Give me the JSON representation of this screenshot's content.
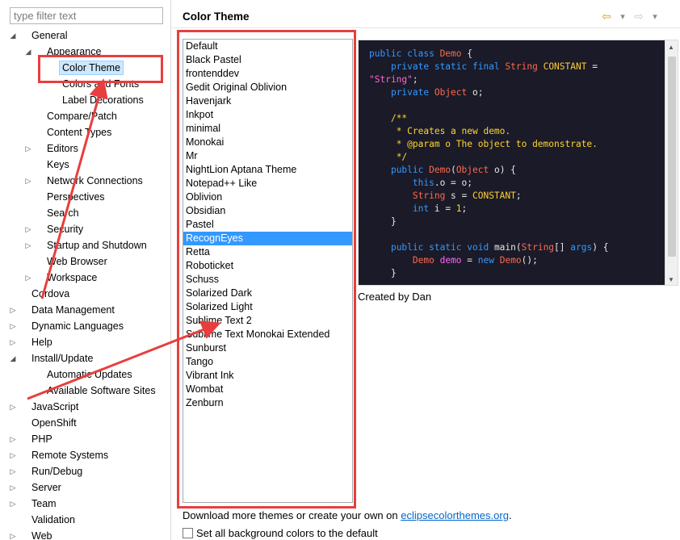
{
  "filter": {
    "placeholder": "type filter text",
    "value": ""
  },
  "tree": [
    {
      "label": "General",
      "depth": 0,
      "expander": "open",
      "selected": false
    },
    {
      "label": "Appearance",
      "depth": 1,
      "expander": "open",
      "selected": false
    },
    {
      "label": "Color Theme",
      "depth": 2,
      "expander": "none",
      "selected": true
    },
    {
      "label": "Colors and Fonts",
      "depth": 2,
      "expander": "none",
      "selected": false
    },
    {
      "label": "Label Decorations",
      "depth": 2,
      "expander": "none",
      "selected": false
    },
    {
      "label": "Compare/Patch",
      "depth": 1,
      "expander": "none",
      "selected": false
    },
    {
      "label": "Content Types",
      "depth": 1,
      "expander": "none",
      "selected": false
    },
    {
      "label": "Editors",
      "depth": 1,
      "expander": "closed",
      "selected": false
    },
    {
      "label": "Keys",
      "depth": 1,
      "expander": "none",
      "selected": false
    },
    {
      "label": "Network Connections",
      "depth": 1,
      "expander": "closed",
      "selected": false
    },
    {
      "label": "Perspectives",
      "depth": 1,
      "expander": "none",
      "selected": false
    },
    {
      "label": "Search",
      "depth": 1,
      "expander": "none",
      "selected": false
    },
    {
      "label": "Security",
      "depth": 1,
      "expander": "closed",
      "selected": false
    },
    {
      "label": "Startup and Shutdown",
      "depth": 1,
      "expander": "closed",
      "selected": false
    },
    {
      "label": "Web Browser",
      "depth": 1,
      "expander": "none",
      "selected": false
    },
    {
      "label": "Workspace",
      "depth": 1,
      "expander": "closed",
      "selected": false
    },
    {
      "label": "Cordova",
      "depth": 0,
      "expander": "none",
      "selected": false
    },
    {
      "label": "Data Management",
      "depth": 0,
      "expander": "closed",
      "selected": false
    },
    {
      "label": "Dynamic Languages",
      "depth": 0,
      "expander": "closed",
      "selected": false
    },
    {
      "label": "Help",
      "depth": 0,
      "expander": "closed",
      "selected": false
    },
    {
      "label": "Install/Update",
      "depth": 0,
      "expander": "open",
      "selected": false
    },
    {
      "label": "Automatic Updates",
      "depth": 1,
      "expander": "none",
      "selected": false
    },
    {
      "label": "Available Software Sites",
      "depth": 1,
      "expander": "none",
      "selected": false
    },
    {
      "label": "JavaScript",
      "depth": 0,
      "expander": "closed",
      "selected": false
    },
    {
      "label": "OpenShift",
      "depth": 0,
      "expander": "none",
      "selected": false
    },
    {
      "label": "PHP",
      "depth": 0,
      "expander": "closed",
      "selected": false
    },
    {
      "label": "Remote Systems",
      "depth": 0,
      "expander": "closed",
      "selected": false
    },
    {
      "label": "Run/Debug",
      "depth": 0,
      "expander": "closed",
      "selected": false
    },
    {
      "label": "Server",
      "depth": 0,
      "expander": "closed",
      "selected": false
    },
    {
      "label": "Team",
      "depth": 0,
      "expander": "closed",
      "selected": false
    },
    {
      "label": "Validation",
      "depth": 0,
      "expander": "none",
      "selected": false
    },
    {
      "label": "Web",
      "depth": 0,
      "expander": "closed",
      "selected": false
    }
  ],
  "header": {
    "title": "Color Theme"
  },
  "themes": [
    "Default",
    "Black Pastel",
    "frontenddev",
    "Gedit Original Oblivion",
    "Havenjark",
    "Inkpot",
    "minimal",
    "Monokai",
    "Mr",
    "NightLion Aptana Theme",
    "Notepad++ Like",
    "Oblivion",
    "Obsidian",
    "Pastel",
    "RecognEyes",
    "Retta",
    "Roboticket",
    "Schuss",
    "Solarized Dark",
    "Solarized Light",
    "Sublime Text 2",
    "Sublime Text Monokai Extended",
    "Sunburst",
    "Tango",
    "Vibrant Ink",
    "Wombat",
    "Zenburn"
  ],
  "selected_theme": "RecognEyes",
  "preview": {
    "author": "Created by Dan",
    "code_lines": [
      [
        [
          "k",
          "public class "
        ],
        [
          "t",
          "Demo"
        ],
        [
          "p",
          " {"
        ]
      ],
      [
        [
          "p",
          "    "
        ],
        [
          "k",
          "private static final "
        ],
        [
          "t",
          "String"
        ],
        [
          "p",
          " "
        ],
        [
          "c",
          "CONSTANT"
        ],
        [
          "p",
          " ="
        ]
      ],
      [
        [
          "s",
          "\"String\""
        ],
        [
          "p",
          ";"
        ]
      ],
      [
        [
          "p",
          "    "
        ],
        [
          "k",
          "private "
        ],
        [
          "t",
          "Object"
        ],
        [
          "p",
          " o;"
        ]
      ],
      [
        [
          "p",
          ""
        ]
      ],
      [
        [
          "p",
          "    "
        ],
        [
          "cm",
          "/**"
        ]
      ],
      [
        [
          "p",
          "    "
        ],
        [
          "cm",
          " * Creates a new demo."
        ]
      ],
      [
        [
          "p",
          "    "
        ],
        [
          "cm",
          " * @param o The object to demonstrate."
        ]
      ],
      [
        [
          "p",
          "    "
        ],
        [
          "cm",
          " */"
        ]
      ],
      [
        [
          "p",
          "    "
        ],
        [
          "k",
          "public "
        ],
        [
          "t",
          "Demo"
        ],
        [
          "p",
          "("
        ],
        [
          "t",
          "Object"
        ],
        [
          "p",
          " o) {"
        ]
      ],
      [
        [
          "p",
          "        "
        ],
        [
          "k",
          "this"
        ],
        [
          "p",
          ".o = o;"
        ]
      ],
      [
        [
          "p",
          "        "
        ],
        [
          "t",
          "String"
        ],
        [
          "p",
          " s = "
        ],
        [
          "c",
          "CONSTANT"
        ],
        [
          "p",
          ";"
        ]
      ],
      [
        [
          "p",
          "        "
        ],
        [
          "k",
          "int"
        ],
        [
          "p",
          " i = "
        ],
        [
          "n",
          "1"
        ],
        [
          "p",
          ";"
        ]
      ],
      [
        [
          "p",
          "    }"
        ]
      ],
      [
        [
          "p",
          ""
        ]
      ],
      [
        [
          "p",
          "    "
        ],
        [
          "k",
          "public static void "
        ],
        [
          "p",
          "main("
        ],
        [
          "t",
          "String"
        ],
        [
          "p",
          "[] "
        ],
        [
          "k",
          "args"
        ],
        [
          "p",
          ") {"
        ]
      ],
      [
        [
          "p",
          "        "
        ],
        [
          "t",
          "Demo"
        ],
        [
          "p",
          " "
        ],
        [
          "v",
          "demo"
        ],
        [
          "p",
          " = "
        ],
        [
          "k",
          "new "
        ],
        [
          "t",
          "Demo"
        ],
        [
          "p",
          "();"
        ]
      ],
      [
        [
          "p",
          "    }"
        ]
      ]
    ]
  },
  "footer": {
    "download_prefix": "Download more themes or create your own on ",
    "download_link": "eclipsecolorthemes.org",
    "download_suffix": ".",
    "default_checkbox_label": "Set all background colors to the default",
    "default_checkbox_checked": false
  },
  "colors": {
    "annotation": "#e83e3e",
    "selection": "#3399ff",
    "preview_background": "#1a1a28"
  },
  "icons": {
    "back": "back-arrow-icon",
    "forward": "forward-arrow-icon",
    "menu": "chevron-down-icon"
  }
}
